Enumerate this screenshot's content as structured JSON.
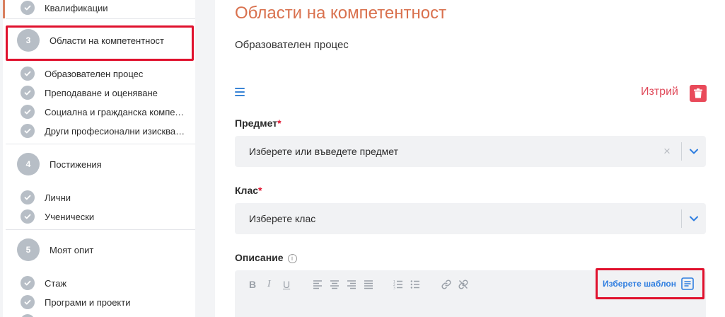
{
  "sidebar": {
    "top_item": "Квалификации",
    "sections": [
      {
        "number": "3",
        "label": "Области на компетентност",
        "items": [
          "Образователен процес",
          "Преподаване и оценяване",
          "Социална и гражданска компетентност",
          "Други професионални изисквания"
        ]
      },
      {
        "number": "4",
        "label": "Постижения",
        "items": [
          "Лични",
          "Ученически"
        ]
      },
      {
        "number": "5",
        "label": "Моят опит",
        "items": [
          "Стаж",
          "Програми и проекти"
        ]
      }
    ]
  },
  "main": {
    "title": "Области на компетентност",
    "subtitle": "Образователен процес",
    "delete_label": "Изтрий",
    "subject": {
      "label": "Предмет",
      "required_mark": "*",
      "placeholder": "Изберете или въведете предмет",
      "clear": "×"
    },
    "grade": {
      "label": "Клас",
      "required_mark": "*",
      "placeholder": "Изберете клас"
    },
    "description": {
      "label": "Описание",
      "info": "i"
    },
    "toolbar": {
      "bold": "B",
      "italic": "I",
      "underline": "U"
    },
    "template_button": "Изберете шаблон"
  },
  "colors": {
    "accent": "#d9714e",
    "link": "#2f7ee0",
    "danger": "#e94a5a",
    "highlight": "#e0112d"
  }
}
